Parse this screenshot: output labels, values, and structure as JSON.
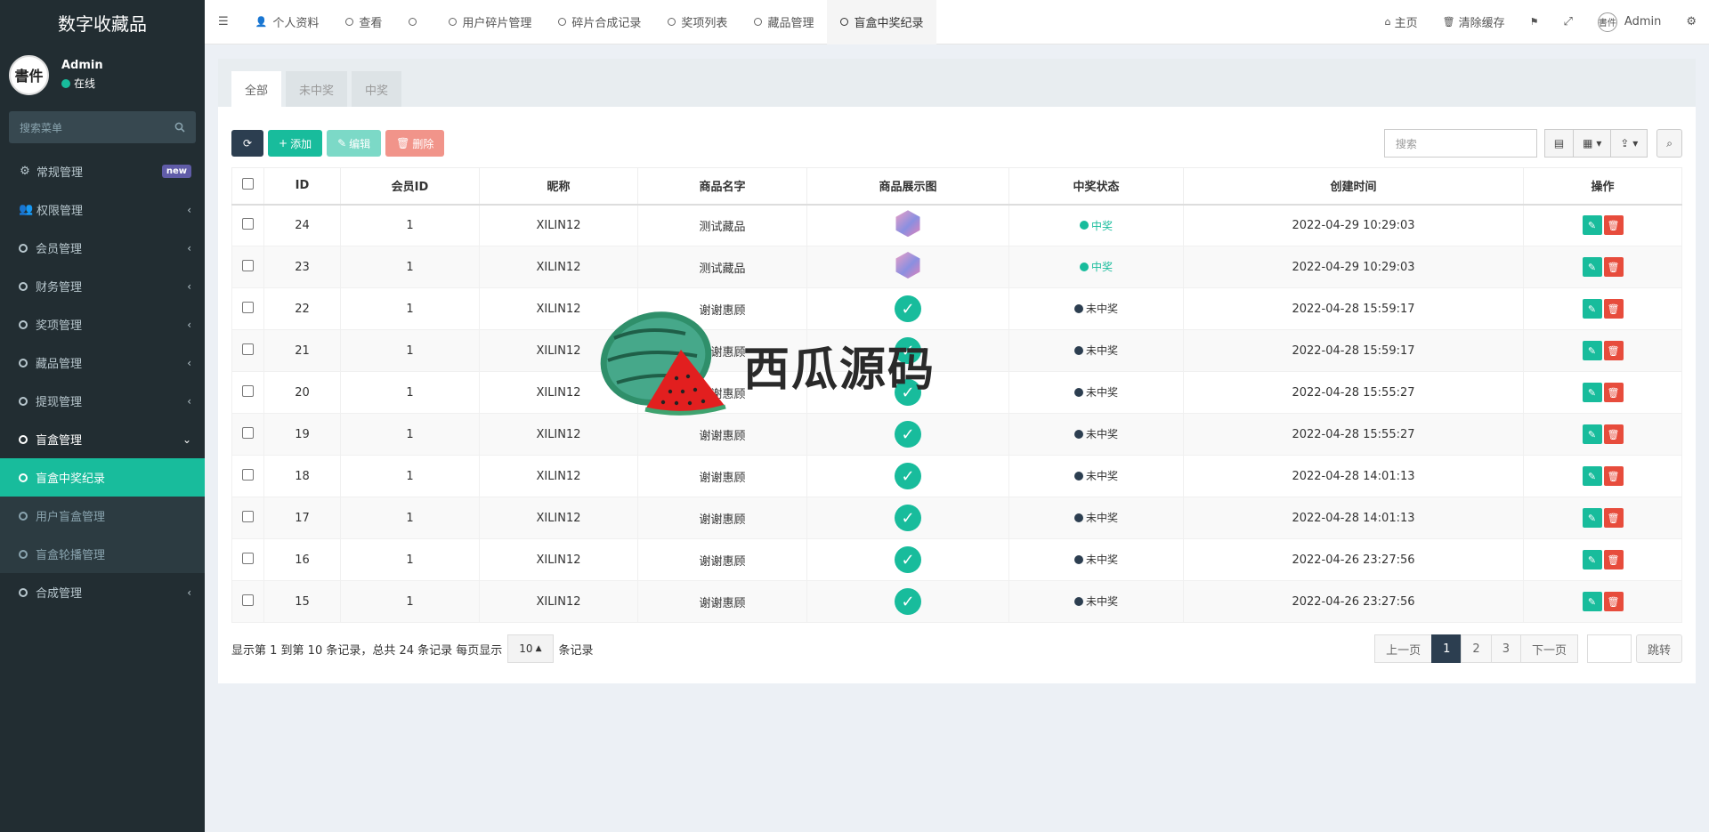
{
  "brand": "数字收藏品",
  "user": {
    "name": "Admin",
    "status": "在线",
    "avatar_text": "書件"
  },
  "sidebar": {
    "search_placeholder": "搜索菜单",
    "items": [
      {
        "label": "常规管理",
        "badge": "new"
      },
      {
        "label": "权限管理"
      },
      {
        "label": "会员管理"
      },
      {
        "label": "财务管理"
      },
      {
        "label": "奖项管理"
      },
      {
        "label": "藏品管理"
      },
      {
        "label": "提现管理"
      },
      {
        "label": "盲盒管理"
      }
    ],
    "sub_items": [
      {
        "label": "盲盒中奖纪录"
      },
      {
        "label": "用户盲盒管理"
      },
      {
        "label": "盲盒轮播管理"
      }
    ],
    "last_item": {
      "label": "合成管理"
    }
  },
  "topnav": {
    "tabs": [
      "个人资料",
      "查看",
      "",
      "用户碎片管理",
      "碎片合成记录",
      "奖项列表",
      "藏品管理",
      "盲盒中奖纪录"
    ],
    "home": "主页",
    "clear_cache": "清除缓存",
    "user": "Admin"
  },
  "panel_tabs": [
    "全部",
    "未中奖",
    "中奖"
  ],
  "toolbar": {
    "add": "添加",
    "edit": "编辑",
    "delete": "删除",
    "search_placeholder": "搜索"
  },
  "table": {
    "headers": [
      "ID",
      "会员ID",
      "昵称",
      "商品名字",
      "商品展示图",
      "中奖状态",
      "创建时间",
      "操作"
    ],
    "rows": [
      {
        "id": "24",
        "member": "1",
        "nick": "XILIN12",
        "name": "测试藏品",
        "img": "gem",
        "status": "中奖",
        "win": true,
        "time": "2022-04-29 10:29:03"
      },
      {
        "id": "23",
        "member": "1",
        "nick": "XILIN12",
        "name": "测试藏品",
        "img": "gem",
        "status": "中奖",
        "win": true,
        "time": "2022-04-29 10:29:03"
      },
      {
        "id": "22",
        "member": "1",
        "nick": "XILIN12",
        "name": "谢谢惠顾",
        "img": "check",
        "status": "未中奖",
        "win": false,
        "time": "2022-04-28 15:59:17"
      },
      {
        "id": "21",
        "member": "1",
        "nick": "XILIN12",
        "name": "谢谢惠顾",
        "img": "check",
        "status": "未中奖",
        "win": false,
        "time": "2022-04-28 15:59:17"
      },
      {
        "id": "20",
        "member": "1",
        "nick": "XILIN12",
        "name": "谢谢惠顾",
        "img": "check",
        "status": "未中奖",
        "win": false,
        "time": "2022-04-28 15:55:27"
      },
      {
        "id": "19",
        "member": "1",
        "nick": "XILIN12",
        "name": "谢谢惠顾",
        "img": "check",
        "status": "未中奖",
        "win": false,
        "time": "2022-04-28 15:55:27"
      },
      {
        "id": "18",
        "member": "1",
        "nick": "XILIN12",
        "name": "谢谢惠顾",
        "img": "check",
        "status": "未中奖",
        "win": false,
        "time": "2022-04-28 14:01:13"
      },
      {
        "id": "17",
        "member": "1",
        "nick": "XILIN12",
        "name": "谢谢惠顾",
        "img": "check",
        "status": "未中奖",
        "win": false,
        "time": "2022-04-28 14:01:13"
      },
      {
        "id": "16",
        "member": "1",
        "nick": "XILIN12",
        "name": "谢谢惠顾",
        "img": "check",
        "status": "未中奖",
        "win": false,
        "time": "2022-04-26 23:27:56"
      },
      {
        "id": "15",
        "member": "1",
        "nick": "XILIN12",
        "name": "谢谢惠顾",
        "img": "check",
        "status": "未中奖",
        "win": false,
        "time": "2022-04-26 23:27:56"
      }
    ]
  },
  "footer": {
    "summary": "显示第 1 到第 10 条记录，总共 24 条记录 每页显示",
    "page_size": "10",
    "suffix": "条记录",
    "prev": "上一页",
    "pages": [
      "1",
      "2",
      "3"
    ],
    "next": "下一页",
    "go": "跳转"
  },
  "watermark": "西瓜源码",
  "colors": {
    "accent": "#18bc9c",
    "sidebar": "#222d32",
    "danger": "#e74c3c",
    "dark": "#2c3e50"
  }
}
